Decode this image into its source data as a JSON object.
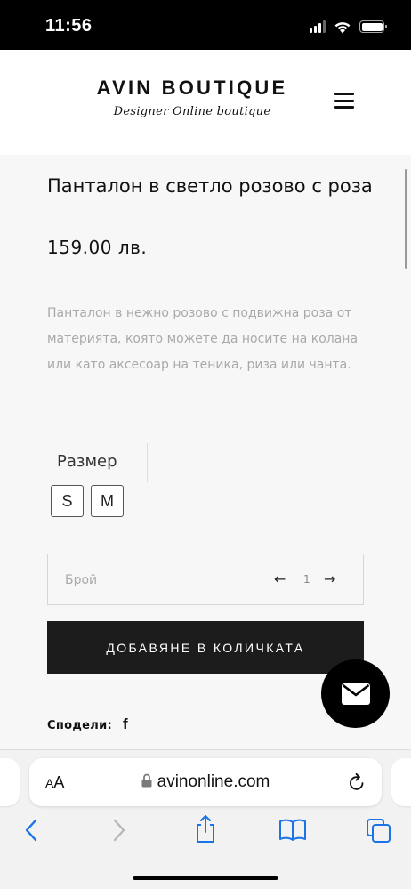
{
  "status_bar": {
    "time": "11:56",
    "icons": [
      "signal-icon",
      "wifi-icon",
      "battery-icon"
    ]
  },
  "header": {
    "brand": "AVIN BOUTIQUE",
    "tagline": "Designer Online boutique",
    "menu_icon": "hamburger-menu-icon"
  },
  "product": {
    "title": "Панталон в светло розово с роза",
    "price": "159.00 лв.",
    "description": "Панталон в нежно розово с подвижна роза от материята, която можете да носите на колана или като аксесоар на теника, риза или чанта."
  },
  "size": {
    "label": "Размер",
    "options": [
      "S",
      "M"
    ]
  },
  "quantity": {
    "label": "Брой",
    "value": "1",
    "decrement_icon": "arrow-left-icon",
    "increment_icon": "arrow-right-icon"
  },
  "cart": {
    "add_label": "ДОБАВЯНЕ В КОЛИЧКАТА"
  },
  "share": {
    "label": "Сподели:",
    "facebook": "f"
  },
  "fab": {
    "icon": "envelope-icon"
  },
  "browser": {
    "aa_label_big": "A",
    "aa_label_small": "A",
    "url": "avinonline.com",
    "toolbar_icons": [
      "back-icon",
      "forward-icon",
      "share-icon",
      "bookmarks-icon",
      "tabs-icon"
    ]
  },
  "colors": {
    "accent_dark": "#1c1c1c",
    "description_text": "#a9a9a9",
    "content_bg": "#f7f7f7",
    "link_blue": "#1a73e8"
  }
}
